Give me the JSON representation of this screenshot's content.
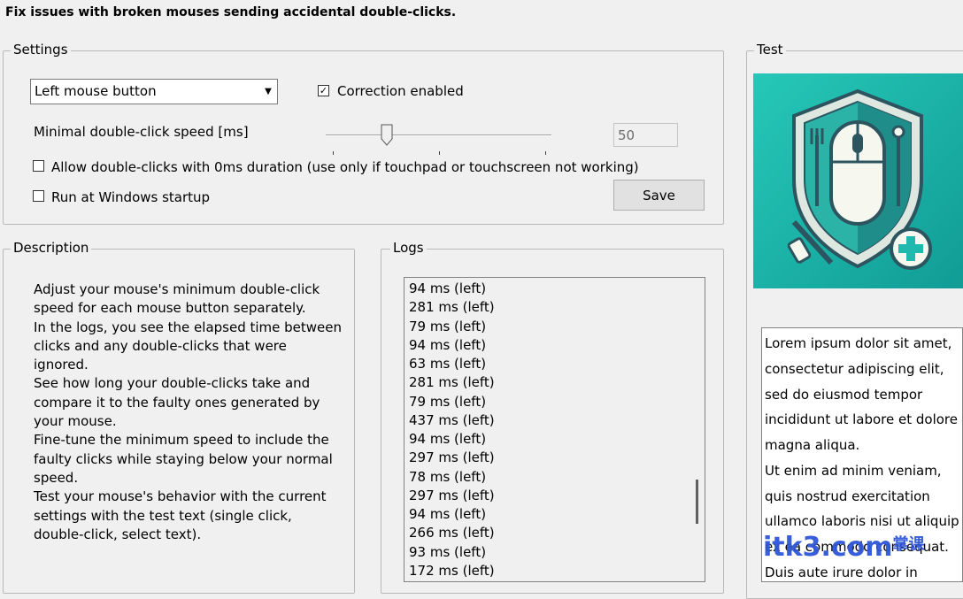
{
  "title": "Fix issues with broken mouses sending accidental double-clicks.",
  "settings": {
    "legend": "Settings",
    "mouse_button_selected": "Left mouse button",
    "correction_label": "Correction enabled",
    "correction_checked": true,
    "speed_label": "Minimal double-click speed [ms]",
    "speed_value": "50",
    "allow_zero_label": "Allow double-clicks with 0ms duration (use only if touchpad or touchscreen not working)",
    "allow_zero_checked": false,
    "startup_label": "Run at Windows startup",
    "startup_checked": false,
    "save_label": "Save"
  },
  "description": {
    "legend": "Description",
    "lines": [
      "Adjust your mouse's minimum double-click",
      "speed for each mouse button separately.",
      "In the logs, you see the elapsed time between",
      "clicks and any double-clicks that were",
      "ignored.",
      "See how long your double-clicks take and",
      "compare it to the faulty ones generated by",
      "your mouse.",
      "Fine-tune the minimum speed to include the",
      "faulty clicks while staying below your normal",
      "speed.",
      "Test your mouse's behavior with the current",
      "settings with the test text (single click,",
      "double-click, select text)."
    ]
  },
  "logs": {
    "legend": "Logs",
    "entries": [
      "94 ms (left)",
      "281 ms (left)",
      "79 ms (left)",
      "94 ms (left)",
      "63 ms (left)",
      "281 ms (left)",
      "79 ms (left)",
      "437 ms (left)",
      "94 ms (left)",
      "297 ms (left)",
      "78 ms (left)",
      "297 ms (left)",
      "94 ms (left)",
      "266 ms (left)",
      "93 ms (left)",
      "172 ms (left)"
    ]
  },
  "test": {
    "legend": "Test",
    "lines": [
      "Lorem ipsum dolor sit amet,",
      "consectetur adipiscing elit,",
      "sed do eiusmod tempor",
      "incididunt ut labore et dolore",
      "magna aliqua.",
      "Ut enim ad minim veniam,",
      "quis nostrud exercitation",
      "ullamco laboris nisi ut aliquip",
      "ex ea commodo consequat.",
      "Duis aute irure dolor in"
    ]
  },
  "watermark": {
    "latin": "itk3.com",
    "cn": "掌课"
  },
  "colors": {
    "image_bg": "#1fb9ad",
    "watermark": "#2f56d8"
  }
}
